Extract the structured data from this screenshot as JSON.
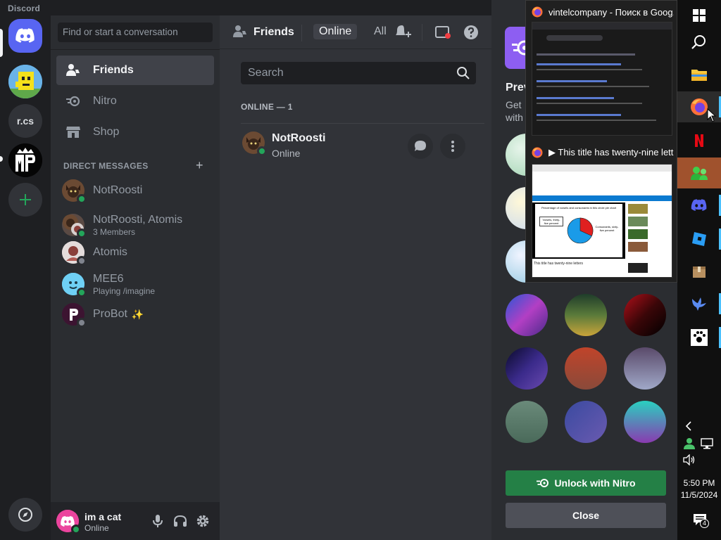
{
  "app": {
    "name": "Discord"
  },
  "rail": {
    "servers": [
      {
        "name": "home",
        "label": ""
      },
      {
        "name": "server-1",
        "label": ""
      },
      {
        "name": "server-2",
        "label": "r.cs"
      },
      {
        "name": "server-3",
        "label": ""
      }
    ]
  },
  "sidebar": {
    "search_placeholder": "Find or start a conversation",
    "nav": [
      {
        "label": "Friends",
        "icon": "friends-icon",
        "active": true
      },
      {
        "label": "Nitro",
        "icon": "nitro-icon",
        "active": false
      },
      {
        "label": "Shop",
        "icon": "shop-icon",
        "active": false
      }
    ],
    "dm_header": "DIRECT MESSAGES",
    "dms": [
      {
        "name": "NotRoosti",
        "sub": "",
        "status": "online"
      },
      {
        "name": "NotRoosti, Atomis",
        "sub": "3 Members",
        "status": "online"
      },
      {
        "name": "Atomis",
        "sub": "",
        "status": "offline"
      },
      {
        "name": "MEE6",
        "sub": "Playing /imagine",
        "status": "online"
      },
      {
        "name": "ProBot",
        "sub": "",
        "status": "offline",
        "badge": "✨"
      }
    ]
  },
  "user": {
    "name": "im a cat",
    "status": "Online"
  },
  "main": {
    "title": "Friends",
    "tabs": {
      "online": "Online",
      "all": "All"
    },
    "search_placeholder": "Search",
    "online_header": "ONLINE — 1",
    "friend": {
      "name": "NotRoosti",
      "status": "Online"
    }
  },
  "nitro_panel": {
    "heading": "Prev",
    "text_line1": "Get",
    "text_line2": "with",
    "unlock_label": "Unlock with Nitro",
    "close_label": "Close"
  },
  "popup": {
    "window1_title": "vintelcompany - Поиск в Goog...",
    "window2_title": "▶ This title has twenty-nine lett...",
    "thumb2_heading": "Percentage of vowels and consonants in this circle pie chart",
    "thumb2_left_label": "Vowels, thirty-five percent",
    "thumb2_right_label": "Consonants, sixty-five percent",
    "thumb2_caption": "This title has twenty-nine letters"
  },
  "taskbar": {
    "time": "5:50 PM",
    "date": "11/5/2024",
    "notifications": "4"
  },
  "colors": {
    "blurple": "#5865f2",
    "online": "#23a55a",
    "nitro_green": "#248046",
    "taskbar_accent": "#4cc2ff"
  }
}
